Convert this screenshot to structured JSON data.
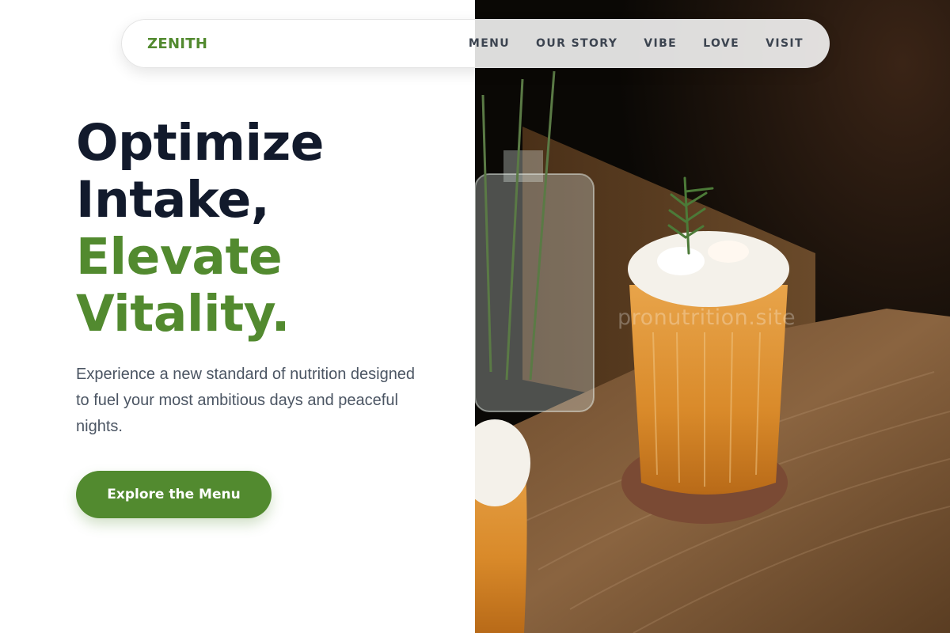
{
  "brand": "ZENITH",
  "nav": {
    "items": [
      "MENU",
      "OUR STORY",
      "VIBE",
      "LOVE",
      "VISIT"
    ]
  },
  "hero": {
    "headline_line1": "Optimize",
    "headline_line2": "Intake,",
    "headline_line3": "Elevate",
    "headline_line4": "Vitality.",
    "subtitle": "Experience a new standard of nutrition designed to fuel your most ambitious days and peaceful nights.",
    "cta_label": "Explore the Menu",
    "image_alt": "Iced amber drink with foam and rosemary sprig on a wooden table",
    "watermark": "pronutrition.site"
  },
  "colors": {
    "accent_green": "#528a2f",
    "headline_dark": "#121a2c",
    "body_text": "#4b5563",
    "nav_text": "#3c4450"
  }
}
